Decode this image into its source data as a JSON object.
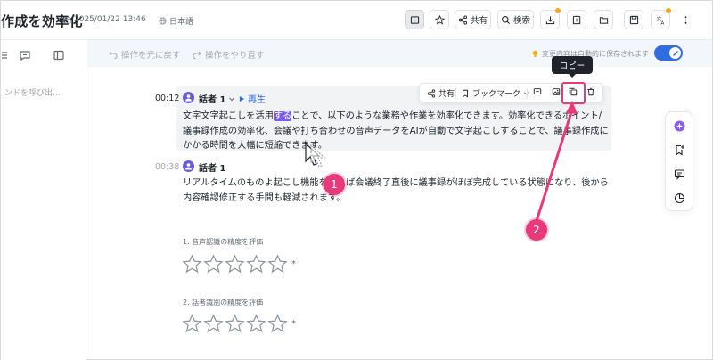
{
  "header": {
    "title": "作成を効率化",
    "date": "2025/01/22 13:46",
    "language": "日本語",
    "share_label": "共有",
    "search_label": "検索"
  },
  "sidebar": {
    "hint": "ンドを呼び出..."
  },
  "editbar": {
    "undo_label": "操作を元に戻す",
    "redo_label": "操作をやり直す",
    "autosave_text": "変更内容は自動的に保存されます"
  },
  "tooltip": {
    "copy": "コピー"
  },
  "segment_toolbar": {
    "share_label": "共有",
    "bookmark_label": "ブックマーク"
  },
  "segments": [
    {
      "time": "00:12",
      "speaker": "話者 1",
      "play_label": "再生",
      "text_before": "文字文字起こしを活用",
      "text_highlight": "する",
      "text_after": "ことで、以下のような業務や作業を効率化できます。効率化できるポイント/議事録作成の効率化、会議や打ち合わせの音声データをAIが自動で文字起こしすることで、議事録作成にかかる時間を大幅に短縮できます。"
    },
    {
      "time": "00:38",
      "speaker": "話者 1",
      "text": "リアルタイムのものよ起こし機能を使えば会議終了直後に議事録がほぼ完成している状態になり、後から内容確認修正する手間も軽減されます。"
    }
  ],
  "ratings": [
    {
      "label": "1. 音声認識の精度を評価",
      "stars": 5,
      "required": "*"
    },
    {
      "label": "2. 話者識別の精度を評価",
      "stars": 5,
      "required": "*"
    }
  ],
  "annotations": {
    "callout_1": "1",
    "callout_2": "2"
  },
  "colors": {
    "accent": "#2f6de0",
    "highlight": "#7c5cf0",
    "callout": "#e8397a",
    "avatar": "#6a5bd8"
  }
}
